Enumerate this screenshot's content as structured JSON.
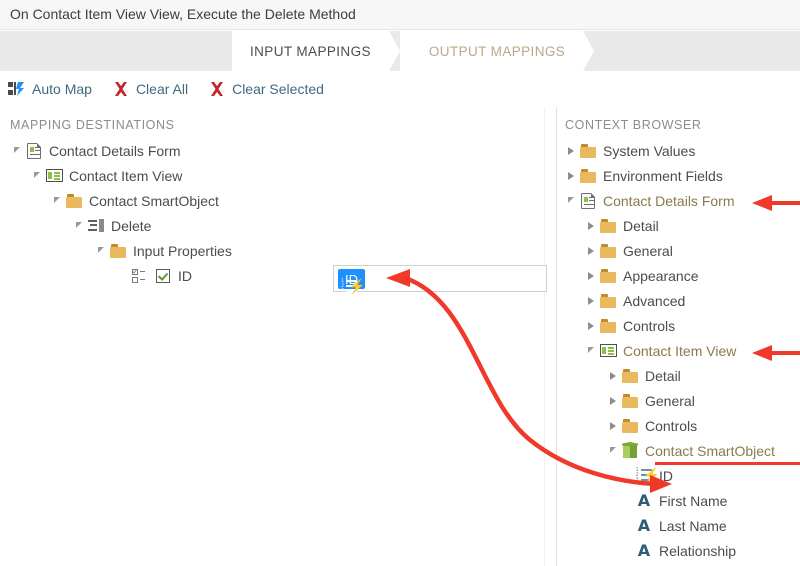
{
  "window": {
    "title": "On Contact Item View View, Execute the Delete Method"
  },
  "tabs": [
    {
      "label": "INPUT MAPPINGS",
      "state": "active"
    },
    {
      "label": "OUTPUT MAPPINGS",
      "state": "inactive"
    }
  ],
  "toolbar": {
    "buttons": [
      {
        "label": "Auto Map",
        "icon": "auto-map-icon"
      },
      {
        "label": "Clear All",
        "icon": "red-x-icon"
      },
      {
        "label": "Clear Selected",
        "icon": "red-x-icon"
      }
    ]
  },
  "panels": {
    "mapping_destinations": {
      "header": "MAPPING DESTINATIONS",
      "nodes": [
        {
          "label": "Contact Details Form",
          "icon": "form-icon",
          "expander": "down",
          "indent": 0
        },
        {
          "label": "Contact Item View",
          "icon": "view-icon",
          "expander": "down",
          "indent": 1
        },
        {
          "label": "Contact SmartObject",
          "icon": "folder-icon",
          "expander": "down",
          "indent": 2
        },
        {
          "label": "Delete",
          "icon": "method-icon",
          "expander": "down",
          "indent": 3
        },
        {
          "label": "Input Properties",
          "icon": "folder-icon",
          "expander": "down",
          "indent": 4
        },
        {
          "label": "ID",
          "icon": "checkbox-property-icon",
          "expander": "none",
          "indent": 5
        }
      ]
    },
    "context_browser": {
      "header": "CONTEXT BROWSER",
      "nodes": [
        {
          "label": "System Values",
          "icon": "folder-icon",
          "expander": "right",
          "indent": 0
        },
        {
          "label": "Environment Fields",
          "icon": "folder-icon",
          "expander": "right",
          "indent": 0
        },
        {
          "label": "Contact Details Form",
          "icon": "form-icon",
          "expander": "down",
          "indent": 0,
          "highlight": "olive",
          "annotated": true
        },
        {
          "label": "Detail",
          "icon": "folder-icon",
          "expander": "right",
          "indent": 1
        },
        {
          "label": "General",
          "icon": "folder-icon",
          "expander": "right",
          "indent": 1
        },
        {
          "label": "Appearance",
          "icon": "folder-icon",
          "expander": "right",
          "indent": 1
        },
        {
          "label": "Advanced",
          "icon": "folder-icon",
          "expander": "right",
          "indent": 1
        },
        {
          "label": "Controls",
          "icon": "folder-icon",
          "expander": "right",
          "indent": 1
        },
        {
          "label": "Contact Item View",
          "icon": "view-icon",
          "expander": "down",
          "indent": 1,
          "highlight": "olive",
          "annotated": true
        },
        {
          "label": "Detail",
          "icon": "folder-icon",
          "expander": "right",
          "indent": 2
        },
        {
          "label": "General",
          "icon": "folder-icon",
          "expander": "right",
          "indent": 2
        },
        {
          "label": "Controls",
          "icon": "folder-icon",
          "expander": "right",
          "indent": 2
        },
        {
          "label": "Contact SmartObject",
          "icon": "cube-icon",
          "expander": "down",
          "indent": 2,
          "highlight": "olive",
          "underlined": true
        },
        {
          "label": "ID",
          "icon": "number-bolt-icon",
          "expander": "none",
          "indent": 3,
          "annotated": true
        },
        {
          "label": "First Name",
          "icon": "text-a-icon",
          "expander": "none",
          "indent": 3
        },
        {
          "label": "Last Name",
          "icon": "text-a-icon",
          "expander": "none",
          "indent": 3
        },
        {
          "label": "Relationship",
          "icon": "text-a-icon",
          "expander": "none",
          "indent": 3
        }
      ]
    }
  },
  "mapping_field": {
    "value_chip": {
      "label": "ID",
      "icon": "number-bolt-icon"
    },
    "placeholder": ""
  },
  "annotations": {
    "arrow_color": "#f0392b",
    "arrows": [
      {
        "name": "arrow-to-contact-details-form",
        "kind": "straight"
      },
      {
        "name": "arrow-to-contact-item-view",
        "kind": "straight"
      },
      {
        "name": "arrow-drag-id-to-field",
        "kind": "curved"
      }
    ]
  },
  "colors": {
    "accent_chip": "#1e90ff",
    "annotation_red": "#f0392b",
    "folder": "#eab95e",
    "tab_active_text": "#4d4d4d",
    "tab_inactive_text": "#b9a88a",
    "toolbar_link": "#3f6a7d"
  }
}
